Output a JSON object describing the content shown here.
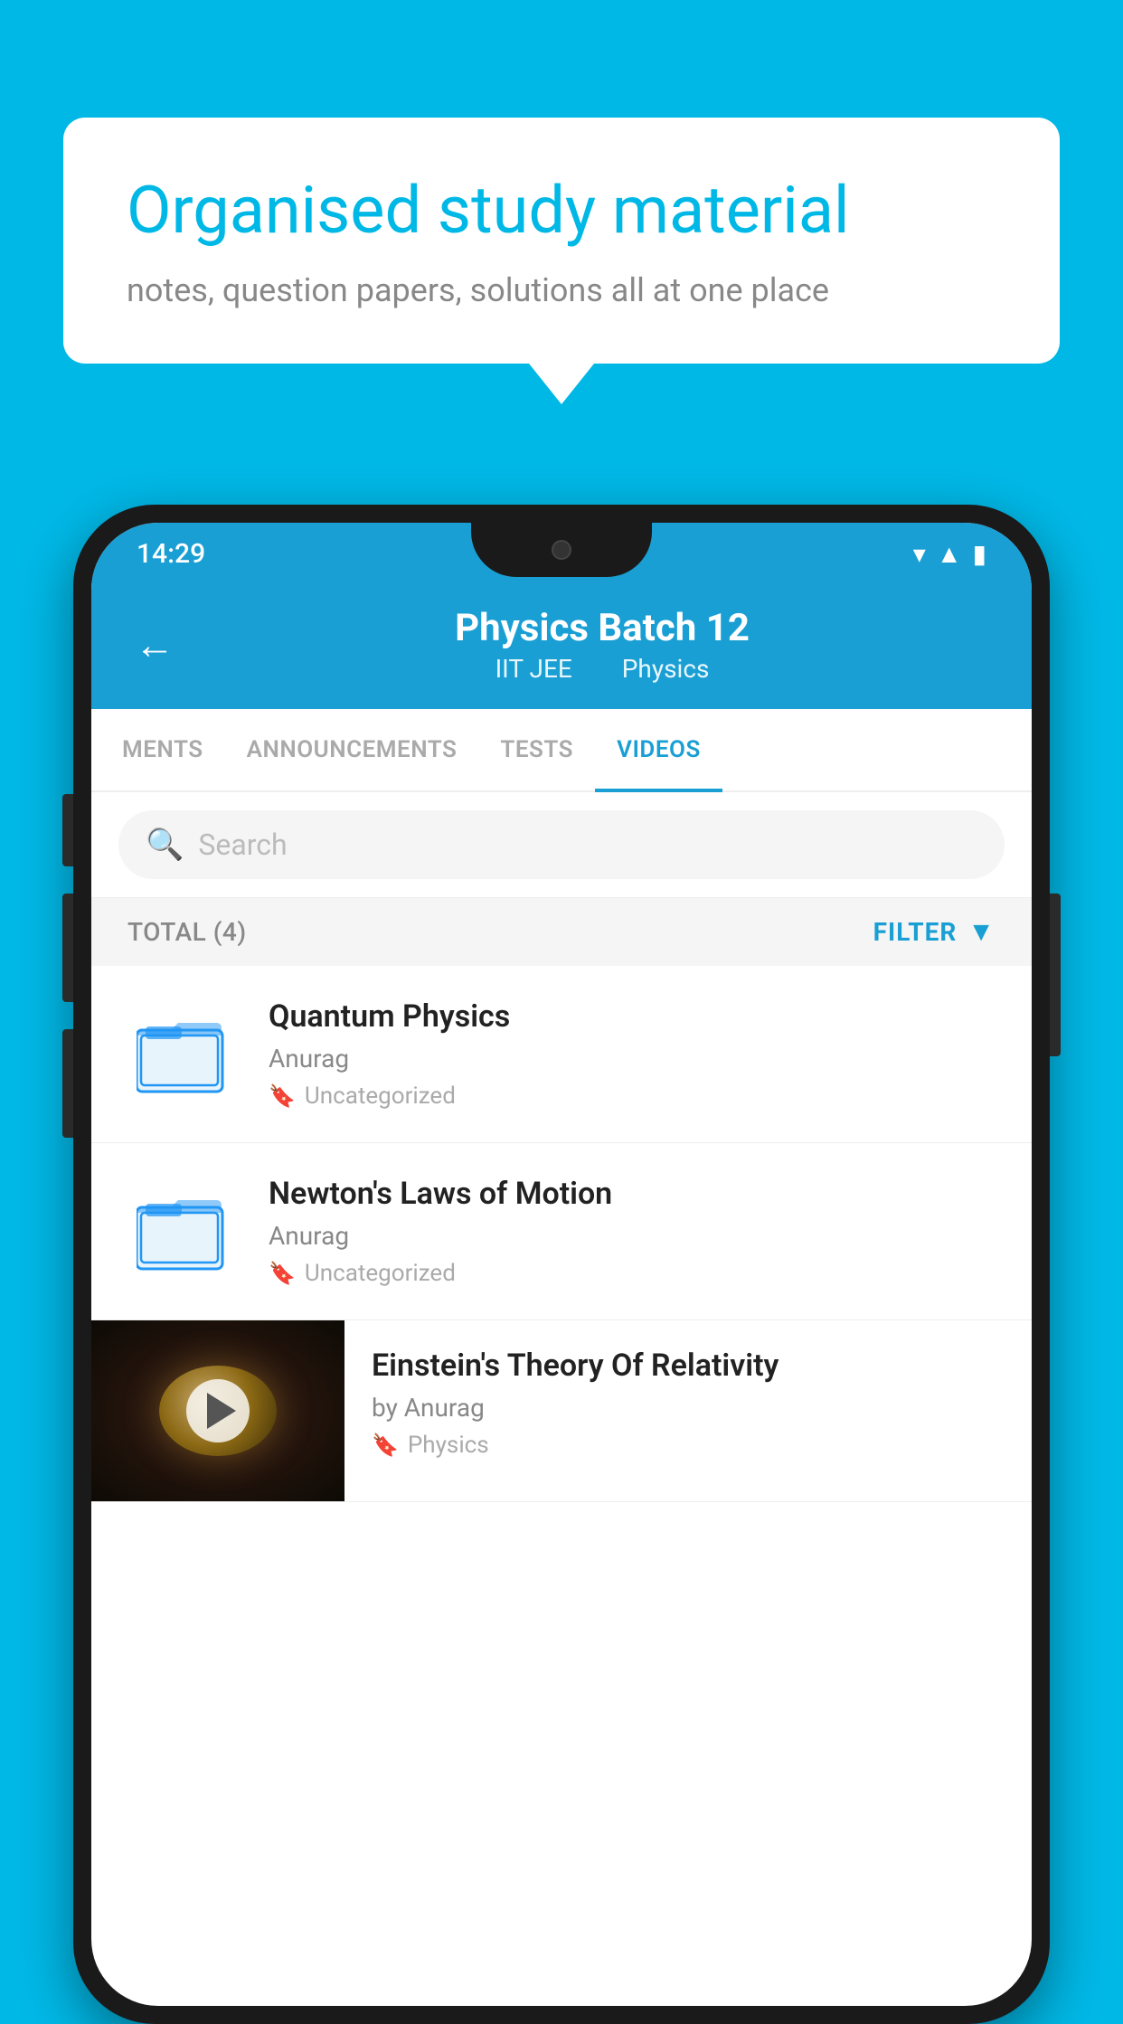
{
  "background": {
    "color": "#00b8e6"
  },
  "speech_bubble": {
    "title": "Organised study material",
    "subtitle": "notes, question papers, solutions all at one place"
  },
  "status_bar": {
    "time": "14:29",
    "icons": [
      "wifi",
      "signal",
      "battery"
    ]
  },
  "header": {
    "title": "Physics Batch 12",
    "subtitle_left": "IIT JEE",
    "subtitle_right": "Physics",
    "back_label": "←"
  },
  "tabs": [
    {
      "label": "MENTS",
      "active": false
    },
    {
      "label": "ANNOUNCEMENTS",
      "active": false
    },
    {
      "label": "TESTS",
      "active": false
    },
    {
      "label": "VIDEOS",
      "active": true
    }
  ],
  "search": {
    "placeholder": "Search"
  },
  "filter_bar": {
    "total_label": "TOTAL (4)",
    "filter_label": "FILTER"
  },
  "videos": [
    {
      "title": "Quantum Physics",
      "author": "Anurag",
      "tag": "Uncategorized",
      "has_thumbnail": false
    },
    {
      "title": "Newton's Laws of Motion",
      "author": "Anurag",
      "tag": "Uncategorized",
      "has_thumbnail": false
    },
    {
      "title": "Einstein's Theory Of Relativity",
      "author": "by Anurag",
      "tag": "Physics",
      "has_thumbnail": true
    }
  ]
}
